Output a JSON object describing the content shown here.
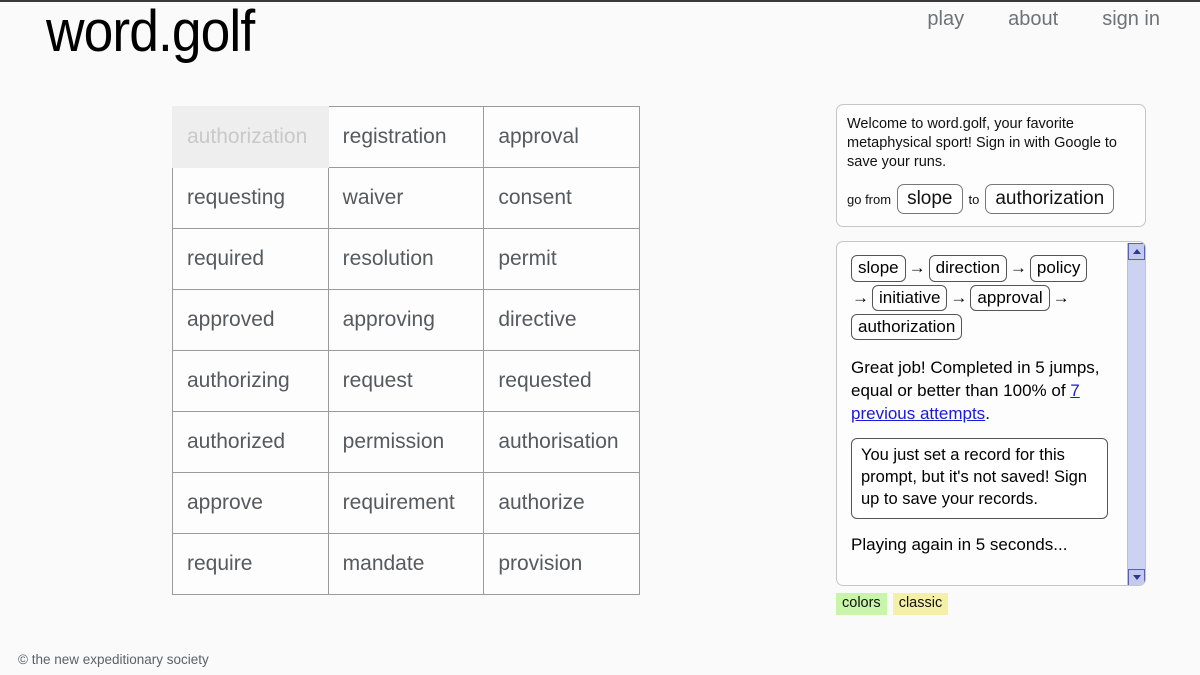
{
  "header": {
    "title": "word.golf",
    "nav": [
      {
        "label": "play",
        "name": "nav-link-play"
      },
      {
        "label": "about",
        "name": "nav-link-about"
      },
      {
        "label": "sign in",
        "name": "nav-link-sign-in"
      }
    ]
  },
  "grid": {
    "rows": [
      [
        "authorization",
        "registration",
        "approval"
      ],
      [
        "requesting",
        "waiver",
        "consent"
      ],
      [
        "required",
        "resolution",
        "permit"
      ],
      [
        "approved",
        "approving",
        "directive"
      ],
      [
        "authorizing",
        "request",
        "requested"
      ],
      [
        "authorized",
        "permission",
        "authorisation"
      ],
      [
        "approve",
        "requirement",
        "authorize"
      ],
      [
        "require",
        "mandate",
        "provision"
      ]
    ],
    "used": [
      [
        0,
        0
      ]
    ]
  },
  "welcome": {
    "message": "Welcome to word.golf, your favorite metaphysical sport! Sign in with Google to save your runs.",
    "go_from_label": "go from",
    "to_label": "to",
    "start_word": "slope",
    "target_word": "authorization"
  },
  "log": {
    "path": [
      "slope",
      "direction",
      "policy",
      "initiative",
      "approval",
      "authorization"
    ],
    "arrow": "→",
    "result_prefix": "Great job! Completed in 5 jumps, equal or better than 100% of ",
    "result_link": "7 previous attempts",
    "result_suffix": ".",
    "record_message": "You just set a record for this prompt, but it's not saved! Sign up to save your records.",
    "countdown": "Playing again in 5 seconds..."
  },
  "badges": [
    {
      "label": "colors",
      "name": "badge-colors",
      "color": "#c9f5ab"
    },
    {
      "label": "classic",
      "name": "badge-classic",
      "color": "#f5f0a8"
    }
  ],
  "footer": {
    "copyright": "© the new expeditionary society"
  },
  "theme": {
    "page_background": "#fafafa",
    "text": "#333333",
    "grid_border": "#9a9a9a",
    "grid_text": "#555a5f",
    "used_cell_background": "#eeeeee",
    "used_cell_text": "#c9c9c9",
    "link": "#1a19d6",
    "nav_text": "#6f7276",
    "scrollbar": "#ccd2f2"
  }
}
